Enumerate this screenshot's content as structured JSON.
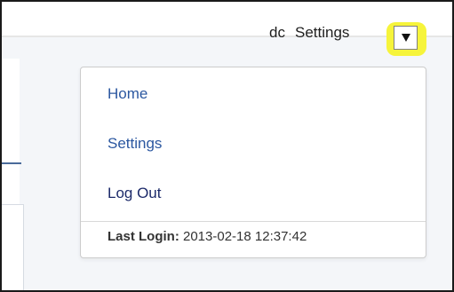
{
  "header": {
    "username": "dc",
    "settings_label": "Settings",
    "dropdown_toggle_icon": "caret-down-icon"
  },
  "dropdown_menu": {
    "items": [
      {
        "label": "Home"
      },
      {
        "label": "Settings"
      },
      {
        "label": "Log Out"
      }
    ],
    "last_login": {
      "label": "Last Login:",
      "value": "2013-02-18 12:37:42"
    }
  },
  "colors": {
    "highlight": "#f6f43b",
    "link": "#2b57a0",
    "text": "#1e1e1e"
  }
}
